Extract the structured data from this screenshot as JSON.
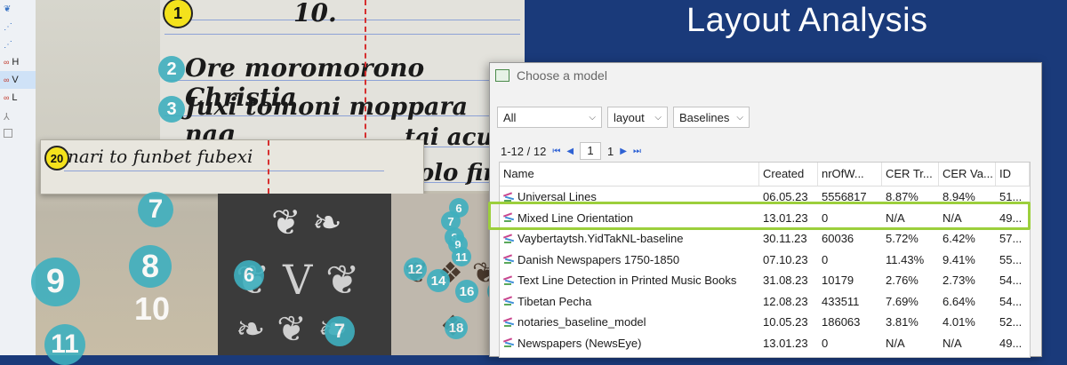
{
  "slide": {
    "title": "Layout Analysis"
  },
  "toolbar": {
    "items": [
      {
        "label": ""
      },
      {
        "label": ""
      },
      {
        "label": ""
      },
      {
        "label": "H"
      },
      {
        "label": "V"
      },
      {
        "label": "L"
      },
      {
        "label": ""
      },
      {
        "label": ""
      }
    ]
  },
  "document": {
    "zoom_text": "nari to funbet fubexi",
    "zoom_marker": "20",
    "line_top_number": "10.",
    "marker_1": "1",
    "lines": [
      "Ore moromorono Christia",
      "Juxi tomoni moppara nag",
      "tai acu",
      "colo fir"
    ],
    "bubbles": [
      "2",
      "3",
      "7",
      "9",
      "8",
      "10",
      "6",
      "7",
      "12",
      "14",
      "16",
      "15",
      "18",
      "6",
      "7",
      "8",
      "9",
      "11",
      "10",
      "11"
    ]
  },
  "dialog": {
    "title": "Choose a model",
    "filter_all": "All",
    "filter_type": "layout",
    "filter_subtype": "Baselines",
    "pager_range": "1-12 / 12",
    "page_input": "1",
    "page_total": "1",
    "columns": [
      "Name",
      "Created",
      "nrOfW...",
      "CER Tr...",
      "CER Va...",
      "ID"
    ],
    "rows": [
      {
        "name": "Universal Lines",
        "created": "06.05.23",
        "nr": "5556817",
        "cert": "8.87%",
        "cerv": "8.94%",
        "id": "51..."
      },
      {
        "name": "Mixed Line Orientation",
        "created": "13.01.23",
        "nr": "0",
        "cert": "N/A",
        "cerv": "N/A",
        "id": "49..."
      },
      {
        "name": "Vaybertaytsh.YidTakNL-baseline",
        "created": "30.11.23",
        "nr": "60036",
        "cert": "5.72%",
        "cerv": "6.42%",
        "id": "57..."
      },
      {
        "name": "Danish Newspapers 1750-1850",
        "created": "07.10.23",
        "nr": "0",
        "cert": "11.43%",
        "cerv": "9.41%",
        "id": "55..."
      },
      {
        "name": "Text Line Detection in Printed Music Books",
        "created": "31.08.23",
        "nr": "10179",
        "cert": "2.76%",
        "cerv": "2.73%",
        "id": "54..."
      },
      {
        "name": "Tibetan Pecha",
        "created": "12.08.23",
        "nr": "433511",
        "cert": "7.69%",
        "cerv": "6.64%",
        "id": "54..."
      },
      {
        "name": "notaries_baseline_model",
        "created": "10.05.23",
        "nr": "186063",
        "cert": "3.81%",
        "cerv": "4.01%",
        "id": "52..."
      },
      {
        "name": "Newspapers (NewsEye)",
        "created": "13.01.23",
        "nr": "0",
        "cert": "N/A",
        "cerv": "N/A",
        "id": "49..."
      }
    ]
  },
  "colors": {
    "highlight": "#9ccf3c",
    "slide_bg": "#1a3a7a",
    "bubble": "#3fb0bf"
  }
}
